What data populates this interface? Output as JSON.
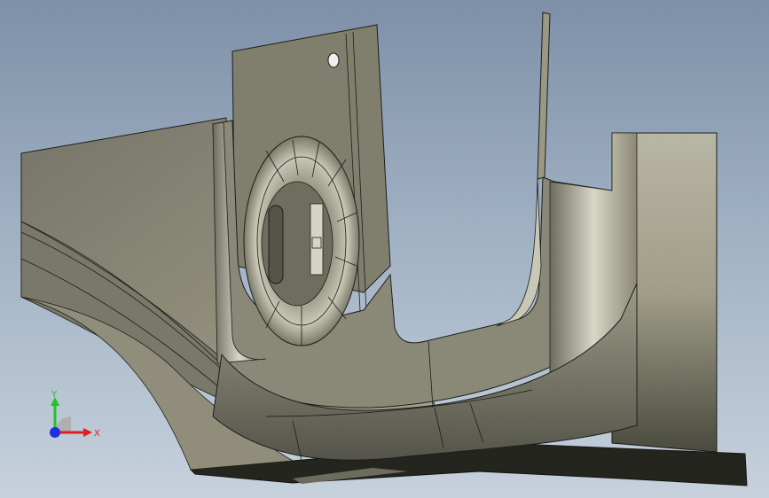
{
  "viewport": {
    "background_top": "#7e90a8",
    "background_bottom": "#c6d1dc",
    "model_face_color": "#8f8d78",
    "model_shadow_color": "#4a4a3f",
    "edge_color": "#1e1e1a"
  },
  "triad": {
    "y_label": "Y",
    "x_label": "X",
    "y_color": "#22c22a",
    "x_color": "#e02020",
    "z_color": "#2030e0",
    "icon": "coordinate-triad-icon"
  }
}
